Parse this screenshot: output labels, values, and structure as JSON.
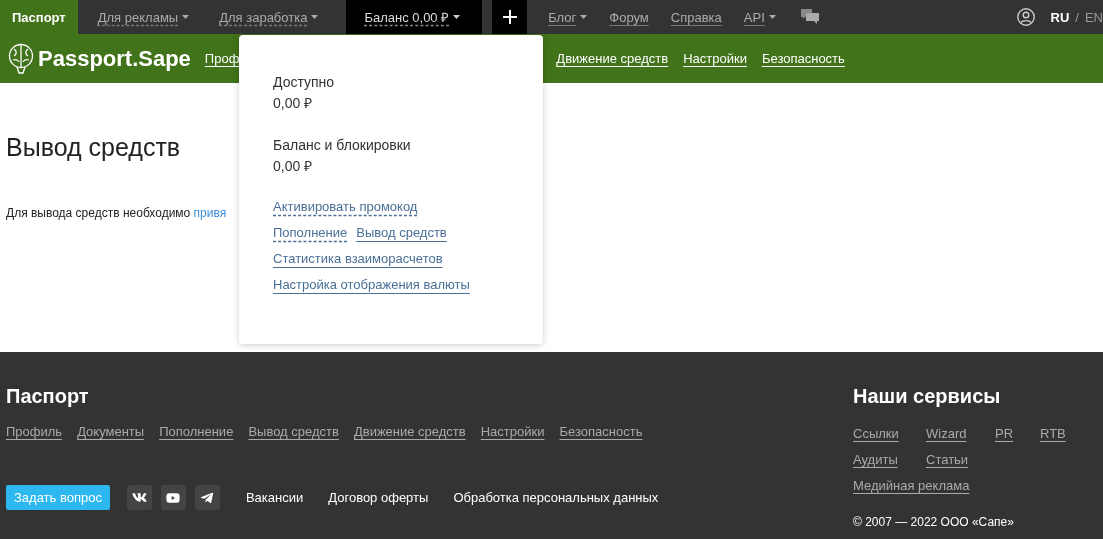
{
  "top_bar": {
    "tabs": [
      {
        "label": "Паспорт",
        "selected": true,
        "dropdown": false
      },
      {
        "label": "Для рекламы",
        "selected": false,
        "dropdown": true
      },
      {
        "label": "Для заработка",
        "selected": false,
        "dropdown": true
      }
    ],
    "balance": {
      "label": "Баланс 0,00 ₽",
      "expanded": true
    },
    "links": [
      {
        "label": "Блог",
        "dropdown": true
      },
      {
        "label": "Форум",
        "dropdown": false
      },
      {
        "label": "Справка",
        "dropdown": false
      },
      {
        "label": "API",
        "dropdown": true
      }
    ],
    "languages": [
      {
        "label": "RU",
        "selected": true
      },
      {
        "label": "EN",
        "selected": false
      }
    ],
    "language_separator": "/"
  },
  "header": {
    "logo": "Passport.Sape",
    "nav": [
      "Проф",
      "Движение средств",
      "Настройки",
      "Безопасность"
    ]
  },
  "balance_menu": {
    "amounts": [
      {
        "label": "Доступно",
        "value": "0,00 ₽"
      },
      {
        "label": "Баланс и блокировки",
        "value": "0,00 ₽"
      }
    ],
    "link_rows": [
      [
        {
          "label": "Активировать промокод",
          "kind": "dashed"
        }
      ],
      [
        {
          "label": "Пополнение",
          "kind": "dashed"
        },
        {
          "label": "Вывод средств",
          "kind": "solid"
        }
      ],
      [
        {
          "label": "Статистика взаиморасчетов",
          "kind": "solid"
        }
      ],
      [
        {
          "label": "Настройка отображения валюты",
          "kind": "solid"
        }
      ]
    ]
  },
  "page": {
    "title": "Вывод средств",
    "text": "Для вывода средств необходимо",
    "link": "привя"
  },
  "footer": {
    "title": "Паспорт",
    "links": [
      "Профиль",
      "Документы",
      "Пополнение",
      "Вывод средств",
      "Движение средств",
      "Настройки",
      "Безопасность"
    ],
    "ask_button": "Задать вопрос",
    "bottom_links": [
      "Вакансии",
      "Договор оферты",
      "Обработка персональных данных"
    ],
    "services_title": "Наши сервисы",
    "services": [
      "Ссылки",
      "Wizard",
      "PR",
      "RTB",
      "Аудиты",
      "Статьи",
      "Медийная реклама"
    ],
    "copyright": "© 2007 — 2022 ООО «Сапе»"
  }
}
